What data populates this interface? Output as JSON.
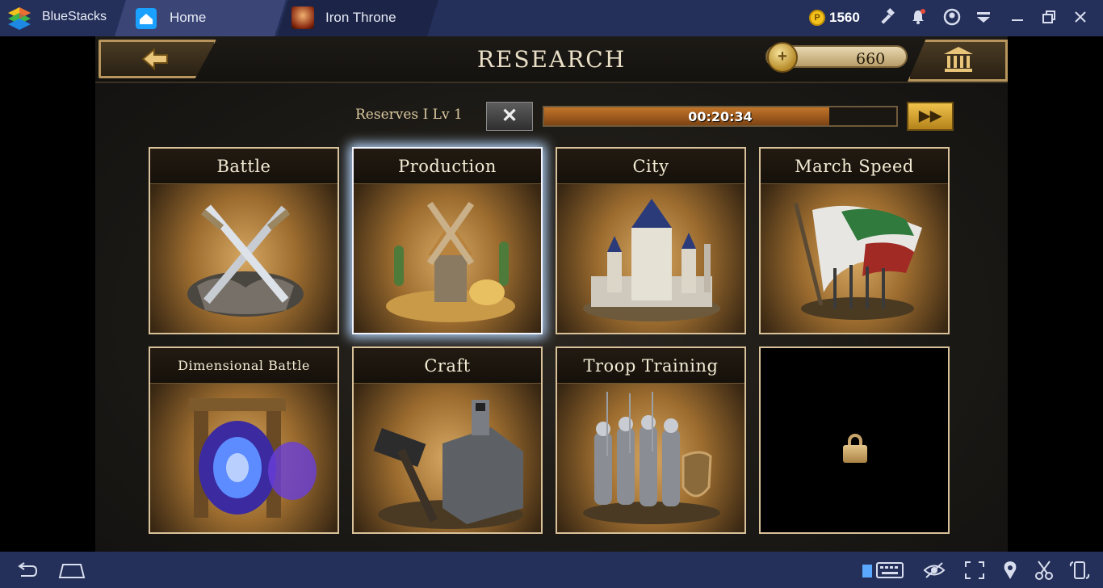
{
  "titlebar": {
    "app_name": "BlueStacks",
    "tabs": [
      {
        "label": "Home",
        "icon": "home-icon"
      },
      {
        "label": "Iron Throne",
        "icon": "game-icon"
      }
    ],
    "coins": "1560",
    "icons": [
      "hammer-icon",
      "bell-icon",
      "account-icon",
      "menu-icon",
      "minimize-icon",
      "restore-icon",
      "close-icon"
    ]
  },
  "game": {
    "title": "RESEARCH",
    "gold": "660",
    "reserve": {
      "label": "Reserves I Lv 1",
      "timer": "00:20:34",
      "progress_fraction": 0.81
    },
    "cards": [
      {
        "label": "Battle",
        "locked": false,
        "selected": false
      },
      {
        "label": "Production",
        "locked": false,
        "selected": true
      },
      {
        "label": "City",
        "locked": false,
        "selected": false
      },
      {
        "label": "March Speed",
        "locked": false,
        "selected": false
      },
      {
        "label": "Dimensional Battle",
        "locked": false,
        "selected": false
      },
      {
        "label": "Craft",
        "locked": false,
        "selected": false
      },
      {
        "label": "Troop Training",
        "locked": false,
        "selected": false
      },
      {
        "label": "",
        "locked": true,
        "selected": false
      }
    ]
  },
  "navbar": {
    "icons": [
      "back-icon",
      "home-icon",
      "keyboard-icon",
      "eye-icon",
      "fullscreen-icon",
      "location-icon",
      "scissors-icon",
      "rotate-icon"
    ]
  }
}
